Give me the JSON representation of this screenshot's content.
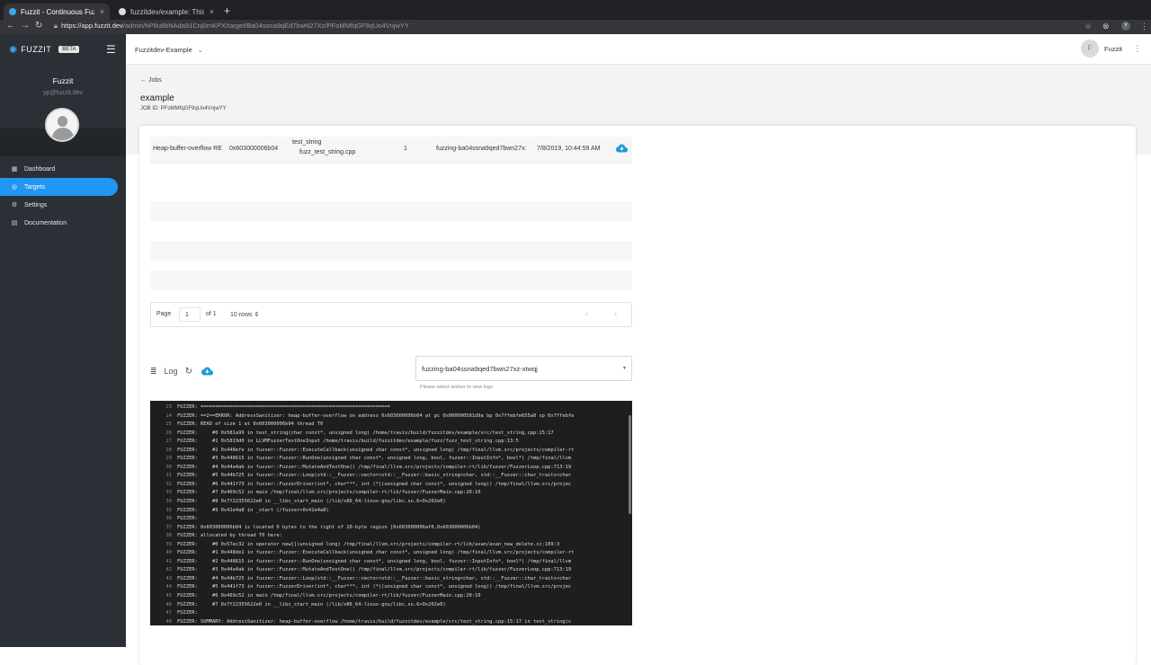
{
  "browser": {
    "tabs": [
      {
        "title": "Fuzzit - Continuous Fuzzing M",
        "active": true
      },
      {
        "title": "fuzzitdev/example: This is an e",
        "active": false
      }
    ],
    "url_host": "https://app.fuzzit.dev",
    "url_path": "/admin/hP8u8bNAda91Cnj0mKPX/target/Ba04ssna9qEd7bwN27Xz/PFoMMfqGF9qUo4VnjwYY",
    "profile_initial": "Y"
  },
  "sidebar": {
    "brand": "FUZZIT",
    "beta": "BETA",
    "user_name": "Fuzzit",
    "user_email": "yp@fuzzit.dev",
    "items": [
      {
        "label": "Dashboard",
        "icon": "dashboard-icon",
        "glyph": "▦"
      },
      {
        "label": "Targets",
        "icon": "target-icon",
        "glyph": "◎"
      },
      {
        "label": "Settings",
        "icon": "gear-icon",
        "glyph": "⚙"
      },
      {
        "label": "Documentation",
        "icon": "book-icon",
        "glyph": "▤"
      }
    ],
    "active": "Targets"
  },
  "topbar": {
    "org": "Fuzzitdev-Example",
    "user_initial": "F",
    "user": "Fuzzit"
  },
  "page": {
    "back": "Jobs",
    "title": "example",
    "job_id": "JOB ID: PFoMMfqGF9qUo4VnjwYY"
  },
  "table": {
    "row": {
      "type": "Heap-buffer-overflow RE",
      "address": "0x603000006b04",
      "function": "test_string",
      "file": "fuzz_test_string.cpp",
      "count": "1",
      "worker": "fuzzing-ba04ssna9qed7bwn27x:",
      "date": "7/8/2019, 10:44:59 AM"
    },
    "page_label": "Page",
    "page_value": "1",
    "of_label": "of 1",
    "rows_label": "10 rows"
  },
  "log": {
    "title": "Log",
    "worker_selected": "fuzzing-ba04ssna9qed7bwn27xz-xtwqj",
    "worker_hint": "Please select worker to view logs",
    "lines": [
      {
        "n": "23",
        "t": "FUZZER: ================================================================="
      },
      {
        "n": "24",
        "t": "FUZZER: ==2==ERROR: AddressSanitizer: heap-buffer-overflow on address 0x603000006b04 at pc 0x000000581d9a bp 0x7ffebfe655a0 sp 0x7ffebfe"
      },
      {
        "n": "25",
        "t": "FUZZER: READ of size 1 at 0x603000006b04 thread T0"
      },
      {
        "n": "26",
        "t": "FUZZER:     #0 0x581a99 in test_string(char const*, unsigned long) /home/travis/build/fuzzitdev/example/src/test_string.cpp:15:17"
      },
      {
        "n": "27",
        "t": "FUZZER:     #1 0x5819d0 in LLVMFuzzerTestOneInput /home/travis/build/fuzzitdev/example/fuzz/fuzz_test_string.cpp:13:5"
      },
      {
        "n": "28",
        "t": "FUZZER:     #2 0x448efe in fuzzer::Fuzzer::ExecuteCallback(unsigned char const*, unsigned long) /tmp/final/llvm.src/projects/compiler-rt"
      },
      {
        "n": "29",
        "t": "FUZZER:     #3 0x448615 in fuzzer::Fuzzer::RunOne(unsigned char const*, unsigned long, bool, fuzzer::InputInfo*, bool*) /tmp/final/llvm"
      },
      {
        "n": "30",
        "t": "FUZZER:     #4 0x44a4ab in fuzzer::Fuzzer::MutateAndTestOne() /tmp/final/llvm.src/projects/compiler-rt/lib/fuzzer/FuzzerLoop.cpp:713:19"
      },
      {
        "n": "31",
        "t": "FUZZER:     #5 0x44b725 in fuzzer::Fuzzer::Loop(std::__Fuzzer::vector<std::__Fuzzer::basic_string<char, std::__Fuzzer::char_traits<char"
      },
      {
        "n": "32",
        "t": "FUZZER:     #6 0x441f73 in fuzzer::FuzzerDriver(int*, char***, int (*)(unsigned char const*, unsigned long)) /tmp/final/llvm.src/projec"
      },
      {
        "n": "33",
        "t": "FUZZER:     #7 0x469c52 in main /tmp/final/llvm.src/projects/compiler-rt/lib/fuzzer/FuzzerMain.cpp:20:10"
      },
      {
        "n": "34",
        "t": "FUZZER:     #8 0x7f22355622e0 in __libc_start_main (/lib/x86_64-linux-gnu/libc.so.6+0x202e0)"
      },
      {
        "n": "35",
        "t": "FUZZER:     #9 0x41e4a8 in _start (/fuzzer+0x41e4a8)"
      },
      {
        "n": "36",
        "t": "FUZZER:"
      },
      {
        "n": "37",
        "t": "FUZZER: 0x603000006b04 is located 0 bytes to the right of 20-byte region [0x603000006af0,0x603000006b04)"
      },
      {
        "n": "38",
        "t": "FUZZER: allocated by thread T0 here:"
      },
      {
        "n": "39",
        "t": "FUZZER:     #0 0x57ec32 in operator new[](unsigned long) /tmp/final/llvm.src/projects/compiler-rt/lib/asan/asan_new_delete.cc:109:3"
      },
      {
        "n": "40",
        "t": "FUZZER:     #1 0x448de1 in fuzzer::Fuzzer::ExecuteCallback(unsigned char const*, unsigned long) /tmp/final/llvm.src/projects/compiler-rt"
      },
      {
        "n": "41",
        "t": "FUZZER:     #2 0x448615 in fuzzer::Fuzzer::RunOne(unsigned char const*, unsigned long, bool, fuzzer::InputInfo*, bool*) /tmp/final/llvm"
      },
      {
        "n": "42",
        "t": "FUZZER:     #3 0x44a4ab in fuzzer::Fuzzer::MutateAndTestOne() /tmp/final/llvm.src/projects/compiler-rt/lib/fuzzer/FuzzerLoop.cpp:713:19"
      },
      {
        "n": "43",
        "t": "FUZZER:     #4 0x44b725 in fuzzer::Fuzzer::Loop(std::__Fuzzer::vector<std::__Fuzzer::basic_string<char, std::__Fuzzer::char_traits<char"
      },
      {
        "n": "44",
        "t": "FUZZER:     #5 0x441f73 in fuzzer::FuzzerDriver(int*, char***, int (*)(unsigned char const*, unsigned long)) /tmp/final/llvm.src/projec"
      },
      {
        "n": "45",
        "t": "FUZZER:     #6 0x469c52 in main /tmp/final/llvm.src/projects/compiler-rt/lib/fuzzer/FuzzerMain.cpp:20:10"
      },
      {
        "n": "46",
        "t": "FUZZER:     #7 0x7f22355622e0 in __libc_start_main (/lib/x86_64-linux-gnu/libc.so.6+0x202e0)"
      },
      {
        "n": "47",
        "t": "FUZZER:"
      },
      {
        "n": "48",
        "t": "FUZZER: SUMMARY: AddressSanitizer: heap-buffer-overflow /home/travis/build/fuzzitdev/example/src/test_string.cpp:15:17 in test_string(c"
      }
    ]
  },
  "colors": {
    "accent": "#2196f3",
    "sidebar_bg": "#2b3036",
    "terminal_bg": "#1e1e1e",
    "cloud_icon": "#1e9bd7"
  }
}
